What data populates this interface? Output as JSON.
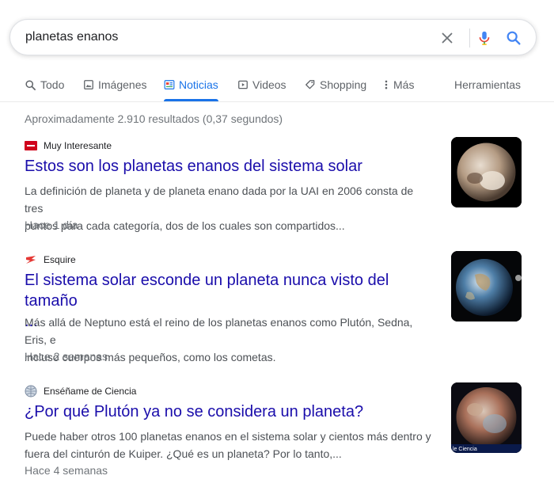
{
  "search": {
    "query": "planetas enanos"
  },
  "tabs": [
    {
      "label": "Todo",
      "icon": "search-icon"
    },
    {
      "label": "Imágenes",
      "icon": "image-icon"
    },
    {
      "label": "Noticias",
      "icon": "news-icon",
      "active": true
    },
    {
      "label": "Videos",
      "icon": "video-icon"
    },
    {
      "label": "Shopping",
      "icon": "tag-icon"
    },
    {
      "label": "Más",
      "icon": "more-vertical-icon"
    }
  ],
  "tools_label": "Herramientas",
  "stats": "Aproximadamente 2.910 resultados (0,37 segundos)",
  "results": [
    {
      "source": "Muy Interesante",
      "title": "Estos son los planetas enanos del sistema solar",
      "snippet_line1": "La definición de planeta y de planeta enano dada por la UAI en 2006 consta de tres",
      "snippet_line2": "puntos para cada categoría, dos de los cuales son compartidos...",
      "time": "Hace 1 día",
      "thumbnail": "pluto-image"
    },
    {
      "source": "Esquire",
      "title_line1": "El sistema solar esconde un planeta nunca visto del tamaño",
      "title_line2": "...",
      "snippet_line1": "Más allá de Neptuno está el reino de los planetas enanos como Plutón, Sedna, Eris, e",
      "snippet_line2": "incluso cuerpos más pequeños, como los cometas.",
      "time": "Hace 2 semanas",
      "thumbnail": "earth-image"
    },
    {
      "source": "Enséñame de Ciencia",
      "title": "¿Por qué Plutón ya no se considera un planeta?",
      "snippet_line1": "Puede haber otros 100 planetas enanos en el sistema solar y cientos más dentro y",
      "snippet_line2": "fuera del cinturón de Kuiper. ¿Qué es un planeta? Por lo tanto,...",
      "time": "Hace 4 semanas",
      "thumbnail": "pluto-color-image",
      "thumbnail_caption": "le Ciencia"
    }
  ],
  "colors": {
    "link": "#1a0dab",
    "accent": "#1a73e8",
    "muted": "#70757a",
    "snippet": "#4d5156"
  }
}
